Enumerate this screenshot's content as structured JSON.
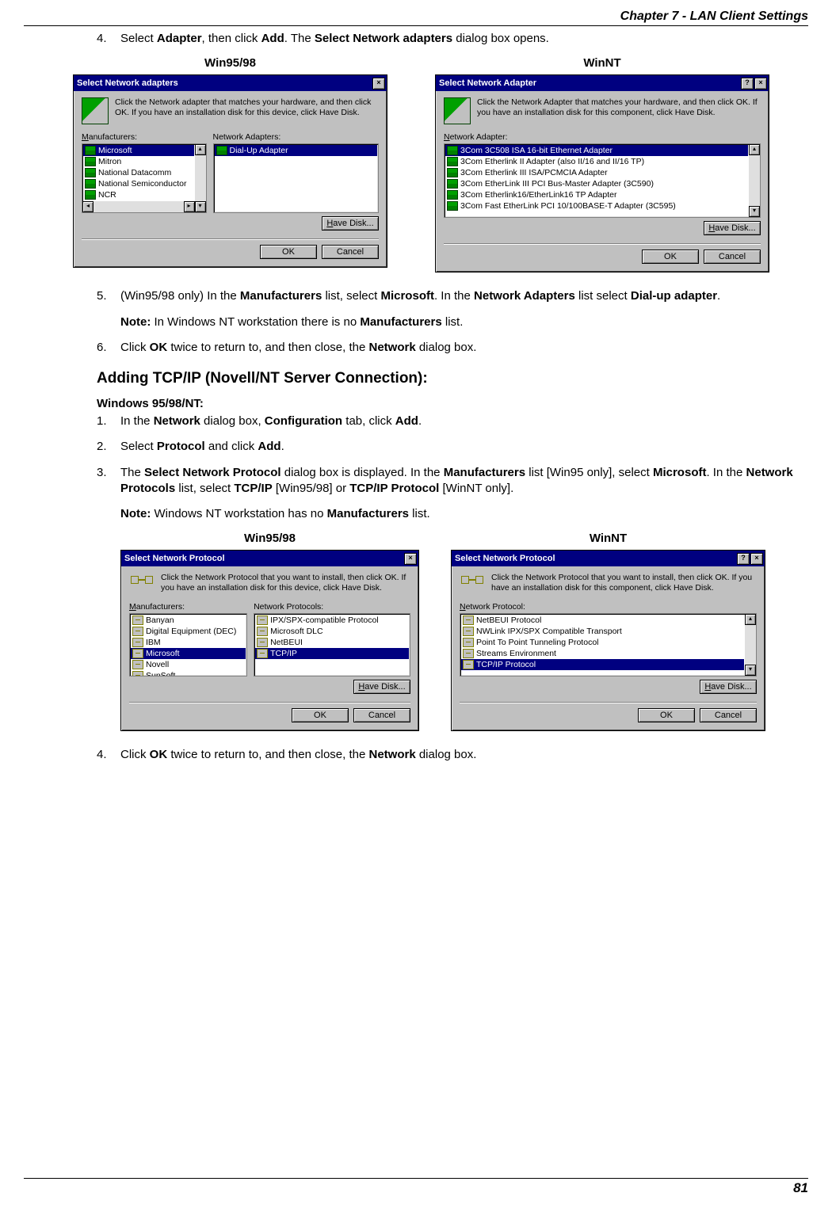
{
  "header": {
    "chapter": "Chapter 7 - LAN Client Settings"
  },
  "step4_intro": {
    "num": "4.",
    "pre": "Select ",
    "b1": "Adapter",
    "mid1": ", then click ",
    "b2": "Add",
    "mid2": ". The ",
    "b3": "Select Network adapters",
    "post": " dialog box opens."
  },
  "labels": {
    "win9598": "Win95/98",
    "winnt": "WinNT"
  },
  "dlg1a": {
    "title": "Select Network adapters",
    "desc": "Click the Network adapter that matches your hardware, and then click OK. If you have an installation disk for this device, click Have Disk.",
    "mfg_label_u": "M",
    "mfg_label_rest": "anufacturers:",
    "adp_label": "Network Adapters:",
    "manufacturers": [
      {
        "name": "Microsoft",
        "selected": true
      },
      {
        "name": "Mitron",
        "selected": false
      },
      {
        "name": "National Datacomm",
        "selected": false
      },
      {
        "name": "National Semiconductor",
        "selected": false
      },
      {
        "name": "NCR",
        "selected": false
      }
    ],
    "adapters": [
      {
        "name": "Dial-Up Adapter",
        "selected": true
      }
    ],
    "have_disk_u": "H",
    "have_disk_rest": "ave Disk...",
    "ok": "OK",
    "cancel": "Cancel"
  },
  "dlg1b": {
    "title": "Select Network Adapter",
    "desc": "Click the Network Adapter that matches your hardware, and then click OK.  If you have an installation disk for this component, click Have Disk.",
    "list_label_u": "N",
    "list_label_rest": "etwork Adapter:",
    "adapters": [
      {
        "name": "3Com 3C508 ISA 16-bit Ethernet Adapter",
        "selected": true
      },
      {
        "name": "3Com Etherlink II Adapter (also II/16 and II/16 TP)",
        "selected": false
      },
      {
        "name": "3Com Etherlink III ISA/PCMCIA Adapter",
        "selected": false
      },
      {
        "name": "3Com EtherLink III PCI Bus-Master Adapter (3C590)",
        "selected": false
      },
      {
        "name": "3Com Etherlink16/EtherLink16 TP Adapter",
        "selected": false
      },
      {
        "name": "3Com Fast EtherLink PCI 10/100BASE-T Adapter (3C595)",
        "selected": false
      }
    ],
    "have_disk_u": "H",
    "have_disk_rest": "ave Disk...",
    "ok": "OK",
    "cancel": "Cancel"
  },
  "step5": {
    "num": "5.",
    "pre": "(Win95/98 only) In the ",
    "b1": "Manufacturers",
    "mid1": " list, select ",
    "b2": "Microsoft",
    "mid2": ". In the ",
    "b3": "Network Adapters",
    "mid3": " list select ",
    "b4": "Dial-up adapter",
    "post": "."
  },
  "note5": {
    "label": "Note:",
    "pre": " In Windows NT workstation there is no ",
    "b1": "Manufacturers",
    "post": " list."
  },
  "step6": {
    "num": "6.",
    "pre": "Click ",
    "b1": "OK",
    "mid1": " twice to return to, and then close, the ",
    "b2": "Network",
    "post": " dialog box."
  },
  "section_heading": "Adding TCP/IP (Novell/NT Server Connection):",
  "sub_heading": "Windows 95/98/NT:",
  "stepB1": {
    "num": "1.",
    "pre": "In the ",
    "b1": "Network",
    "mid1": " dialog box, ",
    "b2": "Configuration",
    "mid2": " tab, click ",
    "b3": "Add",
    "post": "."
  },
  "stepB2": {
    "num": "2.",
    "pre": "Select ",
    "b1": "Protocol",
    "mid1": " and click ",
    "b2": "Add",
    "post": "."
  },
  "stepB3": {
    "num": "3.",
    "pre": "The ",
    "b1": "Select Network Protocol",
    "mid1": " dialog box is displayed. In the ",
    "b2": "Manufacturers",
    "mid2": " list [Win95 only], select ",
    "b3": "Microsoft",
    "mid3": ". In the ",
    "b4": "Network Protocols",
    "mid4": " list, select ",
    "b5": "TCP/IP",
    "mid5": " [Win95/98] or ",
    "b6": "TCP/IP Protocol",
    "post": " [WinNT only]."
  },
  "noteB3": {
    "label": "Note:",
    "pre": " Windows NT workstation has no ",
    "b1": "Manufacturers",
    "post": " list."
  },
  "dlg2a": {
    "title": "Select Network Protocol",
    "desc": "Click the Network Protocol that you want to install, then click OK. If you have an installation disk for this device, click Have Disk.",
    "mfg_label_u": "M",
    "mfg_label_rest": "anufacturers:",
    "proto_label": "Network Protocols:",
    "manufacturers": [
      {
        "name": "Banyan",
        "selected": false
      },
      {
        "name": "Digital Equipment (DEC)",
        "selected": false
      },
      {
        "name": "IBM",
        "selected": false
      },
      {
        "name": "Microsoft",
        "selected": true
      },
      {
        "name": "Novell",
        "selected": false
      },
      {
        "name": "SunSoft",
        "selected": false
      }
    ],
    "protocols": [
      {
        "name": "IPX/SPX-compatible Protocol",
        "selected": false
      },
      {
        "name": "Microsoft DLC",
        "selected": false
      },
      {
        "name": "NetBEUI",
        "selected": false
      },
      {
        "name": "TCP/IP",
        "selected": true
      }
    ],
    "have_disk_u": "H",
    "have_disk_rest": "ave Disk...",
    "ok": "OK",
    "cancel": "Cancel"
  },
  "dlg2b": {
    "title": "Select Network Protocol",
    "desc": "Click the Network Protocol that you want to install, then click OK.  If you have an installation disk for this component, click Have Disk.",
    "list_label_u": "N",
    "list_label_rest": "etwork Protocol:",
    "protocols": [
      {
        "name": "NetBEUI Protocol",
        "selected": false
      },
      {
        "name": "NWLink IPX/SPX Compatible Transport",
        "selected": false
      },
      {
        "name": "Point To Point Tunneling Protocol",
        "selected": false
      },
      {
        "name": "Streams Environment",
        "selected": false
      },
      {
        "name": "TCP/IP Protocol",
        "selected": true
      }
    ],
    "have_disk_u": "H",
    "have_disk_rest": "ave Disk...",
    "ok": "OK",
    "cancel": "Cancel"
  },
  "stepB4": {
    "num": "4.",
    "pre": "Click ",
    "b1": "OK",
    "mid1": " twice to return to, and then close, the ",
    "b2": "Network",
    "post": " dialog box."
  },
  "page_number": "81"
}
